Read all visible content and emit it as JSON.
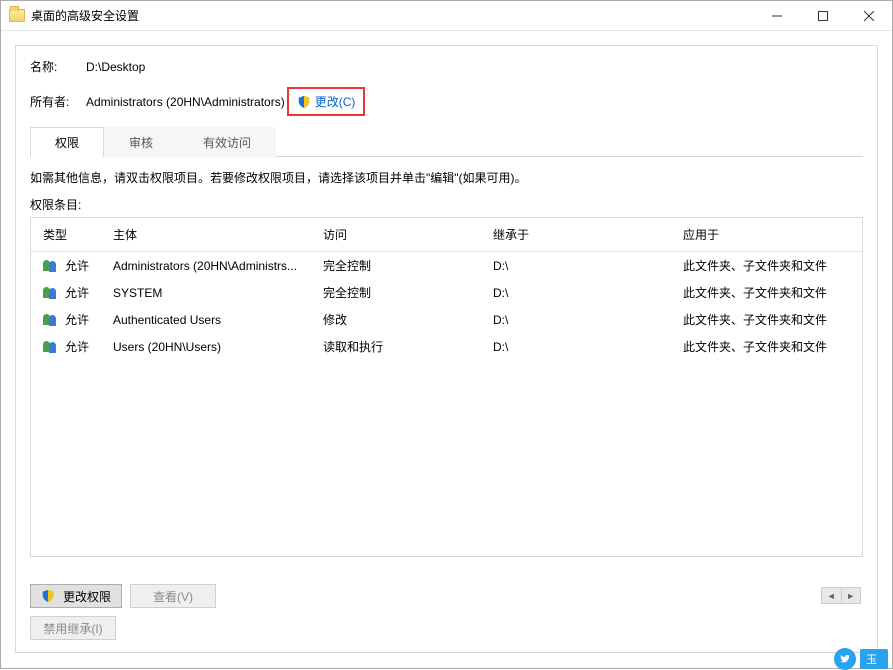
{
  "window": {
    "title": "桌面的高级安全设置"
  },
  "info": {
    "name_label": "名称:",
    "name_value": "D:\\Desktop",
    "owner_label": "所有者:",
    "owner_value": "Administrators (20HN\\Administrators)",
    "change_link": "更改(C)"
  },
  "tabs": [
    {
      "label": "权限",
      "active": true
    },
    {
      "label": "审核",
      "active": false
    },
    {
      "label": "有效访问",
      "active": false
    }
  ],
  "hint": "如需其他信息，请双击权限项目。若要修改权限项目，请选择该项目并单击\"编辑\"(如果可用)。",
  "section_label": "权限条目:",
  "columns": {
    "type": "类型",
    "principal": "主体",
    "access": "访问",
    "inherited": "继承于",
    "applies": "应用于"
  },
  "rows": [
    {
      "type": "允许",
      "principal": "Administrators (20HN\\Administrs...",
      "access": "完全控制",
      "inherited": "D:\\",
      "applies": "此文件夹、子文件夹和文件"
    },
    {
      "type": "允许",
      "principal": "SYSTEM",
      "access": "完全控制",
      "inherited": "D:\\",
      "applies": "此文件夹、子文件夹和文件"
    },
    {
      "type": "允许",
      "principal": "Authenticated Users",
      "access": "修改",
      "inherited": "D:\\",
      "applies": "此文件夹、子文件夹和文件"
    },
    {
      "type": "允许",
      "principal": "Users (20HN\\Users)",
      "access": "读取和执行",
      "inherited": "D:\\",
      "applies": "此文件夹、子文件夹和文件"
    }
  ],
  "buttons": {
    "edit_perm": "更改权限",
    "view": "查看(V)",
    "disable_inherit": "禁用继承(I)"
  },
  "watermark": "玉"
}
